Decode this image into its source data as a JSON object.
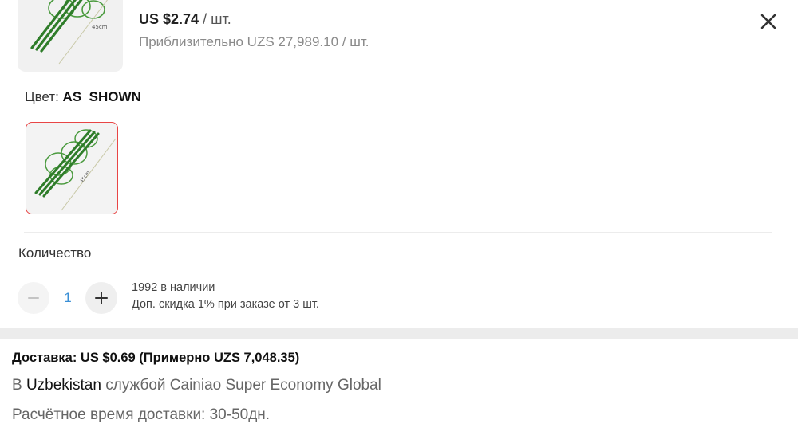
{
  "product": {
    "price_value": "US $2.74",
    "price_unit": " / шт.",
    "approx_price": "Приблизительно UZS 27,989.10 / шт."
  },
  "icons": {
    "close": "close-icon",
    "minus": "minus-icon",
    "plus": "plus-icon",
    "product": "plant-support-stake-image"
  },
  "color_option": {
    "label": "Цвет: ",
    "value": "AS  SHOWN",
    "image_caption": "45cm"
  },
  "quantity": {
    "label": "Количество",
    "value": "1",
    "stock": "1992 в наличии",
    "discount_note": "Доп. скидка 1% при заказе от 3 шт."
  },
  "shipping": {
    "title": "Доставка: US $0.69 (Примерно UZS 7,048.35)",
    "prefix": "В ",
    "country": "Uzbekistan",
    "method": " службой Cainiao Super Economy Global",
    "eta": "Расчётное время доставки: 30-50дн."
  },
  "colors": {
    "accent_border": "#e84545",
    "qty_value": "#3a8fd6",
    "stake_green": "#2f7d2a"
  }
}
